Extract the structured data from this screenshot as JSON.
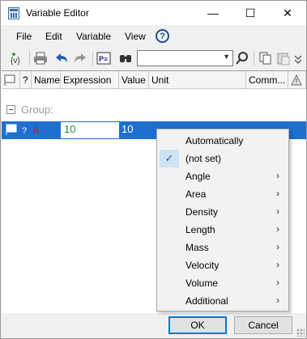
{
  "window": {
    "title": "Variable Editor"
  },
  "titlebar": {
    "minimize": "—",
    "maximize": "☐",
    "close": "✕"
  },
  "menu": {
    "items": [
      "File",
      "Edit",
      "Variable",
      "View"
    ],
    "help": "?"
  },
  "toolbar": {
    "search_value": ""
  },
  "grid": {
    "columns": [
      "",
      "?",
      "Name",
      "Expression",
      "Value",
      "Unit",
      "Comm...",
      ""
    ],
    "group_label": "Group:",
    "row": {
      "name": "a",
      "expression": "10",
      "value": "10",
      "unit": "",
      "comment": ""
    }
  },
  "context_menu": {
    "items": [
      {
        "label": "Automatically",
        "checked": false,
        "submenu": false
      },
      {
        "label": "(not set)",
        "checked": true,
        "submenu": false
      },
      {
        "label": "Angle",
        "checked": false,
        "submenu": true
      },
      {
        "label": "Area",
        "checked": false,
        "submenu": true
      },
      {
        "label": "Density",
        "checked": false,
        "submenu": true
      },
      {
        "label": "Length",
        "checked": false,
        "submenu": true
      },
      {
        "label": "Mass",
        "checked": false,
        "submenu": true
      },
      {
        "label": "Velocity",
        "checked": false,
        "submenu": true
      },
      {
        "label": "Volume",
        "checked": false,
        "submenu": true
      },
      {
        "label": "Additional",
        "checked": false,
        "submenu": true
      }
    ]
  },
  "footer": {
    "ok": "OK",
    "cancel": "Cancel"
  },
  "colors": {
    "selection": "#1e6fd0",
    "accent": "#0078d7",
    "expression_text": "#2e8b2e",
    "name_text": "#c0203c"
  }
}
